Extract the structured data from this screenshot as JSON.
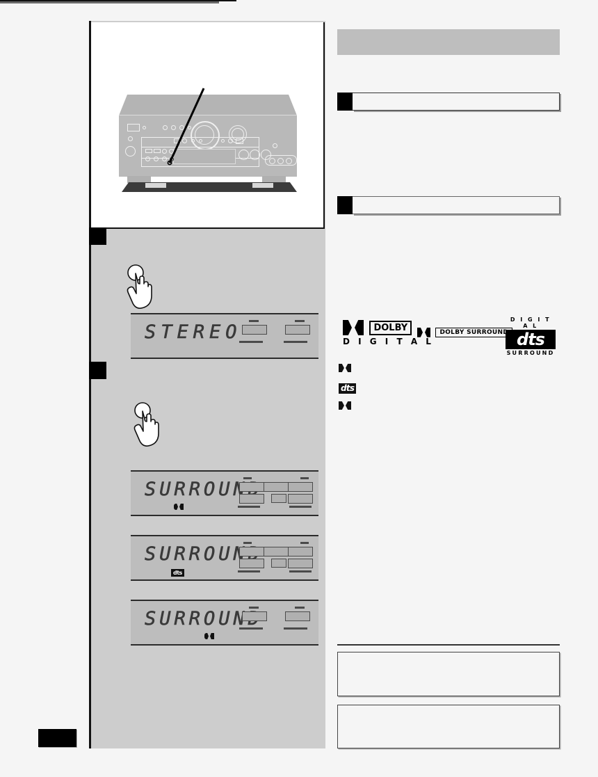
{
  "page": {
    "background_color": "#f5f5f5",
    "page_number_tab": "",
    "illustration_panel_bg": "#ffffff",
    "instruction_column_bg": "#cdcdcd"
  },
  "illustration": {
    "caption": "",
    "device_name": "av-receiver",
    "callout_label": ""
  },
  "steps": [
    {
      "number": "",
      "title": "",
      "body": ""
    },
    {
      "number": "",
      "title": "",
      "body": ""
    }
  ],
  "displays": [
    {
      "id": "lcd-stereo",
      "text": "STEREO",
      "format_badge": "",
      "badge_type": "none",
      "speakers": [
        "L",
        "R"
      ],
      "layout": "stereo"
    },
    {
      "id": "lcd-surround-dolby-digital",
      "text": "SURROUND",
      "format_badge": "dolby-double-d-icon",
      "badge_type": "dolby",
      "speakers": [
        "L",
        "C",
        "R",
        "LS",
        "SW",
        "RS"
      ],
      "layout": "full"
    },
    {
      "id": "lcd-surround-dts",
      "text": "SURROUND",
      "format_badge": "dts",
      "badge_type": "dts",
      "speakers": [
        "L",
        "C",
        "R",
        "LS",
        "SW",
        "RS"
      ],
      "layout": "full"
    },
    {
      "id": "lcd-surround-dolby-prologic",
      "text": "SURROUND",
      "format_badge": "dolby-double-d-icon",
      "badge_type": "dolby",
      "speakers": [
        "L",
        "R"
      ],
      "layout": "stereo"
    }
  ],
  "right_column": {
    "title_bar_text": "",
    "section_headings": [
      {
        "number": "",
        "text": ""
      },
      {
        "number": "",
        "text": ""
      }
    ],
    "logos": {
      "dolby_digital": {
        "word": "DOLBY",
        "sub": "D I G I T A L",
        "mark": "dolby-double-d-icon"
      },
      "dolby_surround": {
        "word": "DOLBY SURROUND",
        "mark": "dolby-double-d-icon"
      },
      "dts": {
        "top": "D I G I T A L",
        "word": "dts",
        "bottom": "SURROUND"
      }
    },
    "format_list": [
      {
        "icon": "dolby-double-d-icon",
        "text": ""
      },
      {
        "icon": "dts-icon",
        "text": ""
      },
      {
        "icon": "dolby-double-d-icon",
        "text": ""
      }
    ],
    "note_boxes": [
      {
        "text": ""
      },
      {
        "text": ""
      }
    ]
  },
  "colors": {
    "page_bg": "#f5f5f5",
    "column_gray": "#cdcdcd",
    "lcd_gray": "#bdbdbd",
    "title_bar_gray": "#bebebe",
    "ink": "#000000",
    "device_gray": "#b9b9b9"
  }
}
